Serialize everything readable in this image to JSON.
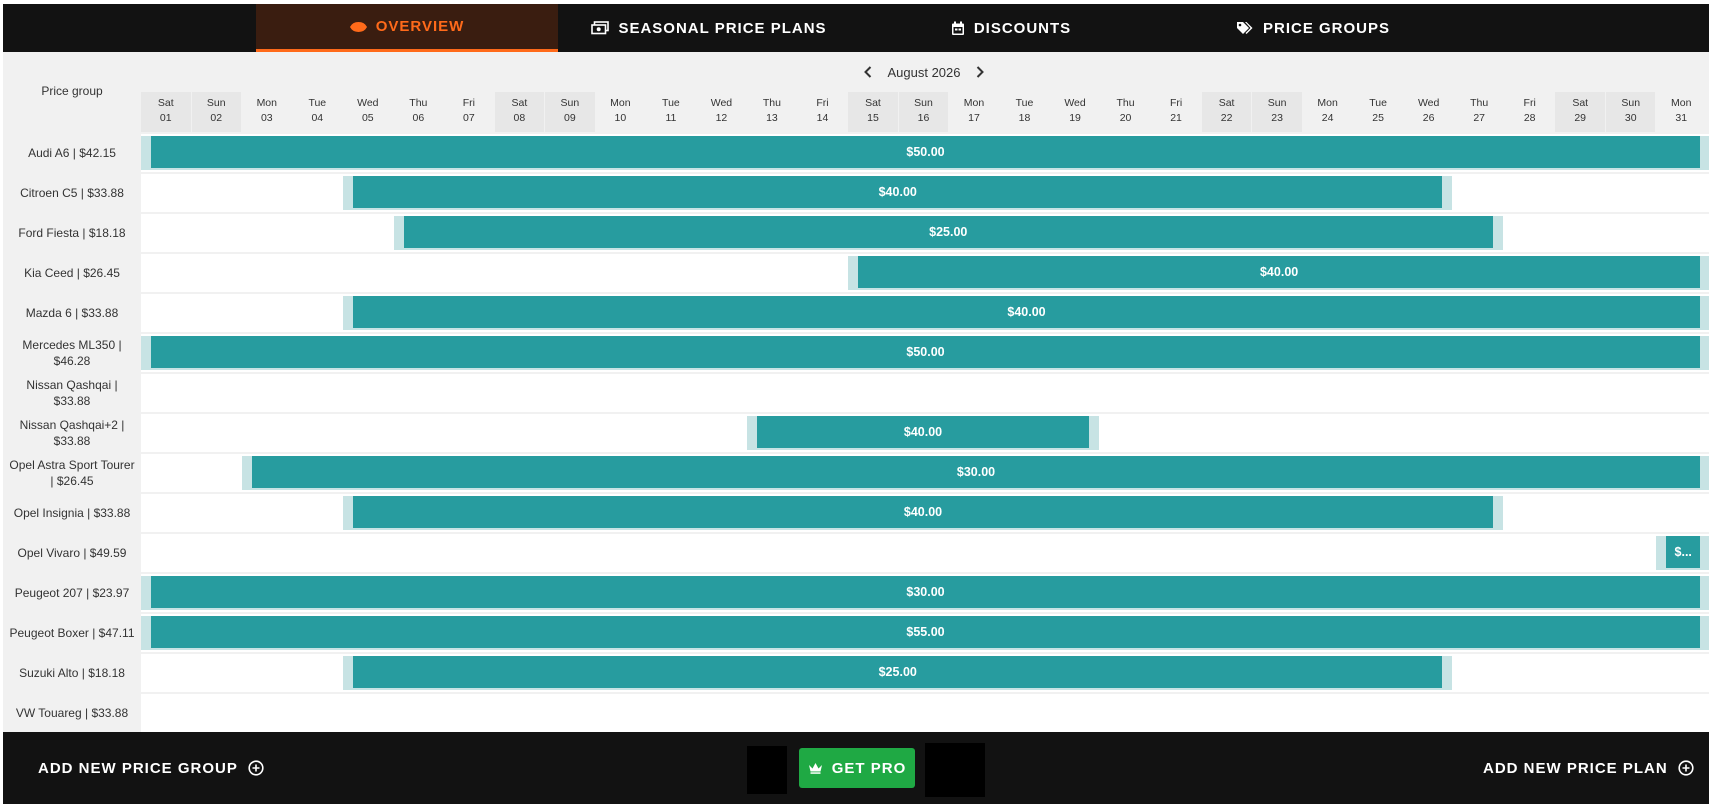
{
  "tabs": [
    {
      "label": "OVERVIEW",
      "icon": "eye-icon",
      "active": true
    },
    {
      "label": "SEASONAL PRICE PLANS",
      "icon": "money-icon",
      "active": false
    },
    {
      "label": "DISCOUNTS",
      "icon": "calendar-icon",
      "active": false
    },
    {
      "label": "PRICE GROUPS",
      "icon": "tags-icon",
      "active": false
    }
  ],
  "calendar": {
    "month_label": "August 2026",
    "price_group_header": "Price group",
    "days": [
      {
        "dow": "Sat",
        "date": "01"
      },
      {
        "dow": "Sun",
        "date": "02"
      },
      {
        "dow": "Mon",
        "date": "03"
      },
      {
        "dow": "Tue",
        "date": "04"
      },
      {
        "dow": "Wed",
        "date": "05"
      },
      {
        "dow": "Thu",
        "date": "06"
      },
      {
        "dow": "Fri",
        "date": "07"
      },
      {
        "dow": "Sat",
        "date": "08"
      },
      {
        "dow": "Sun",
        "date": "09"
      },
      {
        "dow": "Mon",
        "date": "10"
      },
      {
        "dow": "Tue",
        "date": "11"
      },
      {
        "dow": "Wed",
        "date": "12"
      },
      {
        "dow": "Thu",
        "date": "13"
      },
      {
        "dow": "Fri",
        "date": "14"
      },
      {
        "dow": "Sat",
        "date": "15"
      },
      {
        "dow": "Sun",
        "date": "16"
      },
      {
        "dow": "Mon",
        "date": "17"
      },
      {
        "dow": "Tue",
        "date": "18"
      },
      {
        "dow": "Wed",
        "date": "19"
      },
      {
        "dow": "Thu",
        "date": "20"
      },
      {
        "dow": "Fri",
        "date": "21"
      },
      {
        "dow": "Sat",
        "date": "22"
      },
      {
        "dow": "Sun",
        "date": "23"
      },
      {
        "dow": "Mon",
        "date": "24"
      },
      {
        "dow": "Tue",
        "date": "25"
      },
      {
        "dow": "Wed",
        "date": "26"
      },
      {
        "dow": "Thu",
        "date": "27"
      },
      {
        "dow": "Fri",
        "date": "28"
      },
      {
        "dow": "Sat",
        "date": "29"
      },
      {
        "dow": "Sun",
        "date": "30"
      },
      {
        "dow": "Mon",
        "date": "31"
      }
    ]
  },
  "rows": [
    {
      "label": "Audi A6 | $42.15",
      "plan": {
        "price": "$50.00",
        "start": 1,
        "end": 31
      }
    },
    {
      "label": "Citroen C5 | $33.88",
      "plan": {
        "price": "$40.00",
        "start": 5,
        "end": 26
      }
    },
    {
      "label": "Ford Fiesta | $18.18",
      "plan": {
        "price": "$25.00",
        "start": 6,
        "end": 27
      }
    },
    {
      "label": "Kia Ceed | $26.45",
      "plan": {
        "price": "$40.00",
        "start": 15,
        "end": 31
      }
    },
    {
      "label": "Mazda 6 | $33.88",
      "plan": {
        "price": "$40.00",
        "start": 5,
        "end": 31
      }
    },
    {
      "label": "Mercedes ML350 | $46.28",
      "plan": {
        "price": "$50.00",
        "start": 1,
        "end": 31
      }
    },
    {
      "label": "Nissan Qashqai | $33.88",
      "plan": null
    },
    {
      "label": "Nissan Qashqai+2 | $33.88",
      "plan": {
        "price": "$40.00",
        "start": 13,
        "end": 19
      }
    },
    {
      "label": "Opel Astra Sport Tourer | $26.45",
      "plan": {
        "price": "$30.00",
        "start": 3,
        "end": 31
      }
    },
    {
      "label": "Opel Insignia | $33.88",
      "plan": {
        "price": "$40.00",
        "start": 5,
        "end": 27
      }
    },
    {
      "label": "Opel Vivaro | $49.59",
      "plan": {
        "price": "$...",
        "start": 31,
        "end": 31
      }
    },
    {
      "label": "Peugeot 207 | $23.97",
      "plan": {
        "price": "$30.00",
        "start": 1,
        "end": 31
      }
    },
    {
      "label": "Peugeot Boxer | $47.11",
      "plan": {
        "price": "$55.00",
        "start": 1,
        "end": 31
      }
    },
    {
      "label": "Suzuki Alto | $18.18",
      "plan": {
        "price": "$25.00",
        "start": 5,
        "end": 26
      }
    },
    {
      "label": "VW Touareg | $33.88",
      "plan": null
    }
  ],
  "footer": {
    "add_group_label": "ADD NEW PRICE GROUP",
    "get_pro_label": "GET PRO",
    "add_plan_label": "ADD NEW PRICE PLAN"
  },
  "colors": {
    "accent": "#ff6a1a",
    "bar": "#279c9f",
    "bar_edge": "#c7e3e4",
    "get_pro": "#1fa944",
    "topbar": "#121212"
  }
}
